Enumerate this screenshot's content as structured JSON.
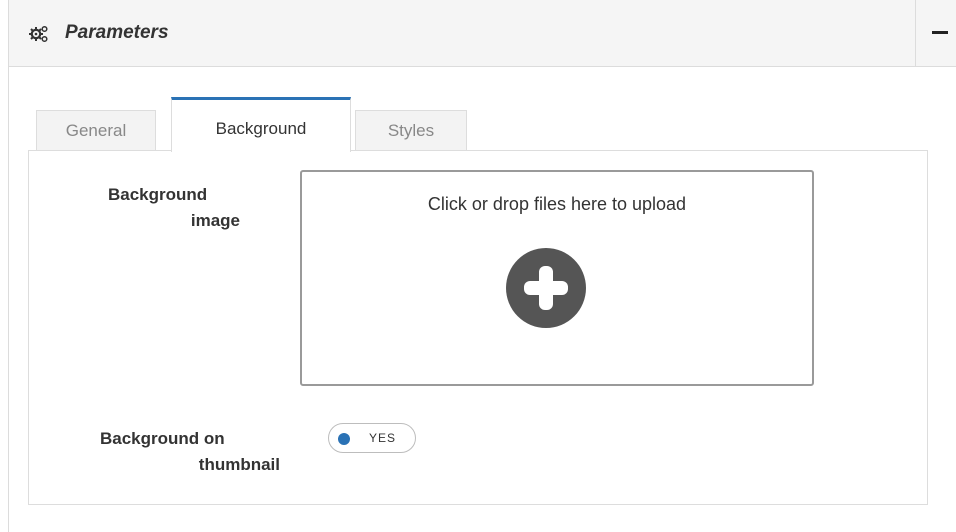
{
  "panel": {
    "title": "Parameters",
    "icon": "gears-icon",
    "collapse_icon": "minus-icon"
  },
  "tabs": [
    {
      "label": "General",
      "active": false
    },
    {
      "label": "Background",
      "active": true
    },
    {
      "label": "Styles",
      "active": false
    }
  ],
  "background_tab": {
    "image_field": {
      "label_line1": "Background",
      "label_line2": "image",
      "dropzone_text": "Click or drop files here to upload",
      "dropzone_icon": "plus-circle-icon"
    },
    "thumbnail_field": {
      "label_line1": "Background on",
      "label_line2": "thumbnail",
      "toggle_value": "YES",
      "toggle_on": true
    }
  },
  "colors": {
    "accent": "#2a72b5",
    "header_bg": "#f5f5f5",
    "upload_icon": "#555555"
  }
}
